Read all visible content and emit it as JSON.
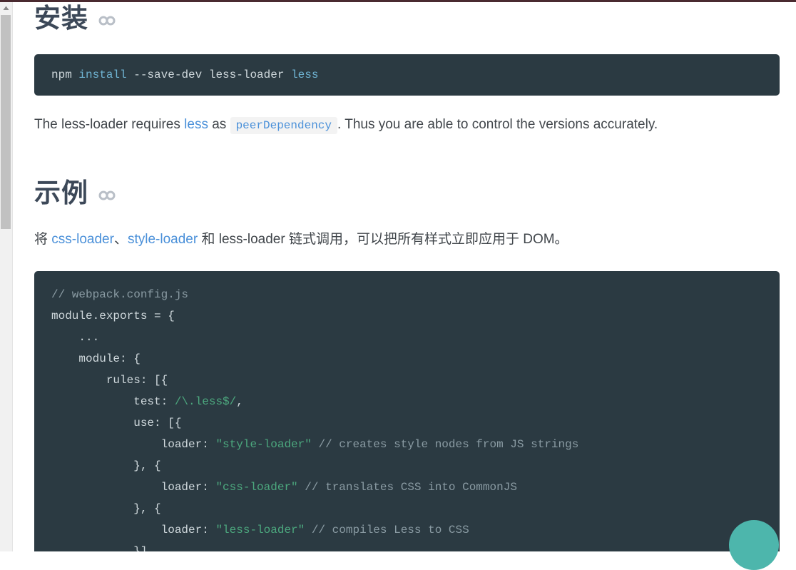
{
  "sections": {
    "install": {
      "heading": "安装",
      "anchor_icon": "link-chain-icon",
      "code": {
        "language": "bash",
        "tokens": [
          {
            "text": "npm ",
            "type": "plain"
          },
          {
            "text": "install",
            "type": "keyword"
          },
          {
            "text": " --save-dev less-loader ",
            "type": "plain"
          },
          {
            "text": "less",
            "type": "keyword"
          }
        ],
        "plain_text": "npm install --save-dev less-loader less"
      },
      "paragraph": {
        "parts": [
          {
            "text": "The less-loader requires ",
            "type": "text"
          },
          {
            "text": "less",
            "type": "link"
          },
          {
            "text": " as ",
            "type": "text"
          },
          {
            "text": "peerDependency",
            "type": "code"
          },
          {
            "text": ". Thus you are able to control the versions accurately.",
            "type": "text"
          }
        ],
        "plain_text": "The less-loader requires less as peerDependency . Thus you are able to control the versions accurately."
      }
    },
    "example": {
      "heading": "示例",
      "anchor_icon": "link-chain-icon",
      "paragraph": {
        "parts": [
          {
            "text": "将 ",
            "type": "text"
          },
          {
            "text": "css-loader",
            "type": "link"
          },
          {
            "text": "、",
            "type": "text"
          },
          {
            "text": "style-loader",
            "type": "link"
          },
          {
            "text": " 和 less-loader 链式调用，可以把所有样式立即应用于 DOM。",
            "type": "text"
          }
        ],
        "plain_text": "将 css-loader、style-loader 和 less-loader 链式调用，可以把所有样式立即应用于 DOM。"
      },
      "code": {
        "language": "javascript",
        "lines": [
          [
            {
              "text": "// webpack.config.js",
              "type": "comment"
            }
          ],
          [
            {
              "text": "module.exports = {",
              "type": "plain"
            }
          ],
          [
            {
              "text": "    ...",
              "type": "plain"
            }
          ],
          [
            {
              "text": "    module: {",
              "type": "plain"
            }
          ],
          [
            {
              "text": "        rules: [{",
              "type": "plain"
            }
          ],
          [
            {
              "text": "            test: ",
              "type": "plain"
            },
            {
              "text": "/\\.less$/",
              "type": "regex"
            },
            {
              "text": ",",
              "type": "plain"
            }
          ],
          [
            {
              "text": "            use: [{",
              "type": "plain"
            }
          ],
          [
            {
              "text": "                loader: ",
              "type": "plain"
            },
            {
              "text": "\"style-loader\"",
              "type": "string"
            },
            {
              "text": " ",
              "type": "plain"
            },
            {
              "text": "// creates style nodes from JS strings",
              "type": "comment"
            }
          ],
          [
            {
              "text": "            }, {",
              "type": "plain"
            }
          ],
          [
            {
              "text": "                loader: ",
              "type": "plain"
            },
            {
              "text": "\"css-loader\"",
              "type": "string"
            },
            {
              "text": " ",
              "type": "plain"
            },
            {
              "text": "// translates CSS into CommonJS",
              "type": "comment"
            }
          ],
          [
            {
              "text": "            }, {",
              "type": "plain"
            }
          ],
          [
            {
              "text": "                loader: ",
              "type": "plain"
            },
            {
              "text": "\"less-loader\"",
              "type": "string"
            },
            {
              "text": " ",
              "type": "plain"
            },
            {
              "text": "// compiles Less to CSS",
              "type": "comment"
            }
          ],
          [
            {
              "text": "            }]",
              "type": "plain"
            }
          ]
        ]
      }
    }
  },
  "scrollbar": {
    "up_arrow_icon": "scroll-up-arrow-icon",
    "position": "left"
  },
  "fab": {
    "icon": "floating-action-button",
    "color": "#4db6ac"
  },
  "colors": {
    "heading": "#3c4858",
    "link": "#4a90d9",
    "code_background": "#2b3a42",
    "code_string": "#4ca87e",
    "code_comment": "#8a9ba3",
    "code_keyword": "#6fb3d2",
    "accent_teal": "#4db6ac",
    "top_strip": "#4a2a30"
  }
}
